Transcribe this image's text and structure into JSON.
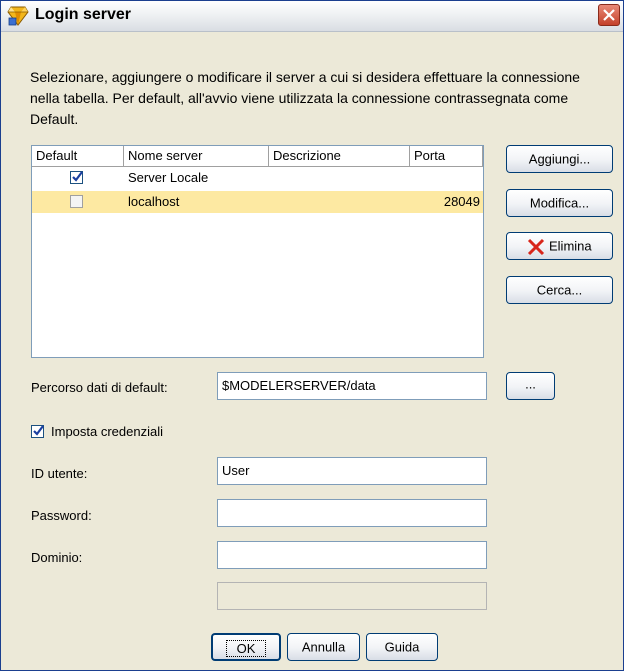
{
  "window": {
    "title": "Login server"
  },
  "description": "Selezionare, aggiungere o modificare il server a cui si desidera effettuare la connessione nella tabella. Per default, all'avvio viene utilizzata la connessione contrassegnata come Default.",
  "table": {
    "columns": [
      "Default",
      "Nome server",
      "Descrizione",
      "Porta"
    ],
    "rows": [
      {
        "default": true,
        "name": "Server Locale",
        "description": "",
        "port": "",
        "selected": false
      },
      {
        "default": false,
        "name": "localhost",
        "description": "",
        "port": "28049",
        "selected": true
      }
    ]
  },
  "buttons": {
    "add": "Aggiungi...",
    "edit": "Modifica...",
    "delete": "Elimina",
    "search": "Cerca...",
    "browse": "...",
    "ok": "OK",
    "cancel": "Annulla",
    "help": "Guida"
  },
  "form": {
    "data_path_label": "Percorso dati di default:",
    "data_path_value": "$MODELERSERVER/data",
    "set_credentials_label": "Imposta credenziali",
    "set_credentials_checked": true,
    "user_id_label": "ID utente:",
    "user_id_value": "User",
    "password_label": "Password:",
    "password_value": "",
    "domain_label": "Dominio:",
    "domain_value": "",
    "extra_value": ""
  },
  "icons": {
    "title": "diamond-icon",
    "close": "close-icon",
    "delete": "red-x-icon"
  },
  "colors": {
    "selected_row": "#fde9a2",
    "accent": "#003c74",
    "close": "#c4412a"
  }
}
